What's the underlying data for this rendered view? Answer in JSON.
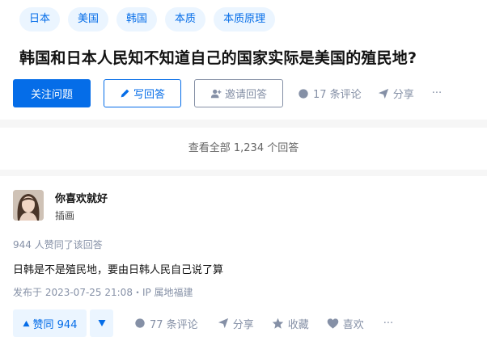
{
  "topics": [
    "日本",
    "美国",
    "韩国",
    "本质",
    "本质原理"
  ],
  "question": {
    "title": "韩国和日本人民知不知道自己的国家实际是美国的殖民地?",
    "follow_label": "关注问题",
    "write_label": "写回答",
    "invite_label": "邀请回答",
    "comments_label": "17 条评论",
    "share_label": "分享",
    "more_label": "···"
  },
  "view_all_label": "查看全部 1,234 个回答",
  "answer": {
    "author_name": "你喜欢就好",
    "author_headline": "插画",
    "likes_text": "944 人赞同了该回答",
    "content": "日韩是不是殖民地，要由日韩人民自己说了算",
    "meta": "发布于 2023-07-25 21:08・IP 属地福建",
    "vote_label": "赞同 944",
    "comments_label": "77 条评论",
    "share_label": "分享",
    "collect_label": "收藏",
    "like_label": "喜欢",
    "more_label": "···"
  },
  "colors": {
    "brand": "#056de8",
    "topic_bg": "#ebf5ff",
    "muted": "#8590a6"
  }
}
